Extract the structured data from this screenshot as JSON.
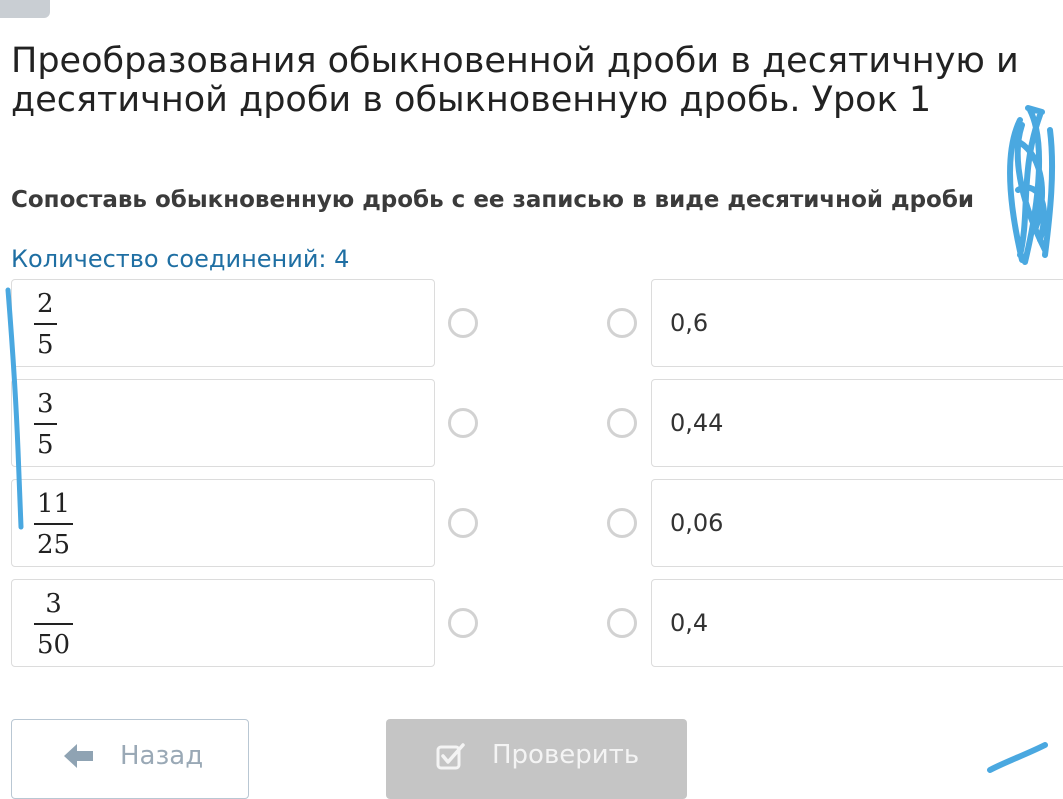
{
  "page": {
    "title": "Преобразования обыкновенной дроби в десятичную и десятичной дроби в обыкновенную дробь. Урок 1"
  },
  "question": {
    "text": "Сопоставь обыкновенную дробь с ее записью в виде десятичной дроби",
    "connections_label": "Количество соединений: 4"
  },
  "left_items": [
    {
      "numerator": "2",
      "denominator": "5"
    },
    {
      "numerator": "3",
      "denominator": "5"
    },
    {
      "numerator": "11",
      "denominator": "25"
    },
    {
      "numerator": "3",
      "denominator": "50"
    }
  ],
  "right_items": [
    {
      "value": "0,6"
    },
    {
      "value": "0,44"
    },
    {
      "value": "0,06"
    },
    {
      "value": "0,4"
    }
  ],
  "buttons": {
    "back_label": "Назад",
    "back_icon": "arrow-left-icon",
    "check_label": "Проверить",
    "check_icon": "checkbox-icon"
  },
  "colors": {
    "accent_text": "#1f6fa3",
    "pen_marks": "#4aa8e0",
    "radio_border": "#d2d2d2",
    "check_button_bg": "#c5c5c5"
  }
}
